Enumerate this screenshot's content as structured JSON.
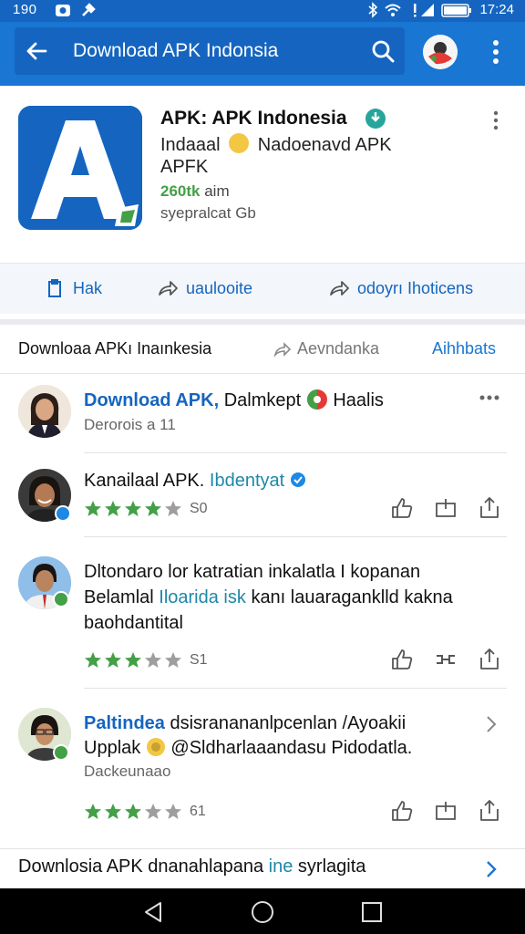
{
  "status_bar": {
    "time_left": "190",
    "time_right": "17:24"
  },
  "search": {
    "query": "Download APK Indonsia"
  },
  "app": {
    "title": "APK: APK Indonesia",
    "developer_a": "Indaaal",
    "developer_b": "Nadoenavd APK",
    "category": "APFK",
    "stat_value": "260tk",
    "stat_label": "aim",
    "size_text": "syepralcat Gb",
    "icon_letter": "A"
  },
  "actions": [
    {
      "label": "Hak",
      "icon": "clipboard-icon"
    },
    {
      "label": "uaulooite",
      "icon": "share-icon"
    },
    {
      "label": "odoyrı Ihoticens",
      "icon": "forward-icon"
    }
  ],
  "reviews_section": {
    "title": "Downloaa APKı Inaınkesia",
    "sort_label": "Aevndanka",
    "link_label": "Aihhbats"
  },
  "reviews": [
    {
      "line1_blue": "Download APK,",
      "line1_rest": "Dalmkept",
      "line1_tail": "Haalis",
      "sub": "Derorois a 11"
    },
    {
      "line1": "Kanailaal APK.",
      "line1_teal": "Ibdentyat",
      "rating_count": "S0",
      "stars": 4
    },
    {
      "line1": "Dltondaro lor katratian inkalatla I kopanan",
      "line2_a": "Belamlal",
      "line2_teal": "Iloarida isk",
      "line2_b": "kanı lauaraganklld kakna",
      "line3": "baohdantital",
      "rating_count": "S1",
      "stars": 3
    },
    {
      "line1_blue": "Paltindea",
      "line1_rest": "dsisranananlpcenlan /Ayoakii",
      "line2_a": "Upplak",
      "line2_b": "@Sldharlaaandasu Pidodatla.",
      "sub": "Dackeunaao",
      "rating_count": "61",
      "stars": 3
    }
  ],
  "bottom_row": {
    "text_a": "Downlosia APK dnanahlapana",
    "text_teal": "ine",
    "text_b": "syrlagita"
  },
  "colors": {
    "primary": "#1976d2",
    "primary_dark": "#1565c0",
    "star": "#43a047",
    "star_empty": "#9e9e9e"
  }
}
